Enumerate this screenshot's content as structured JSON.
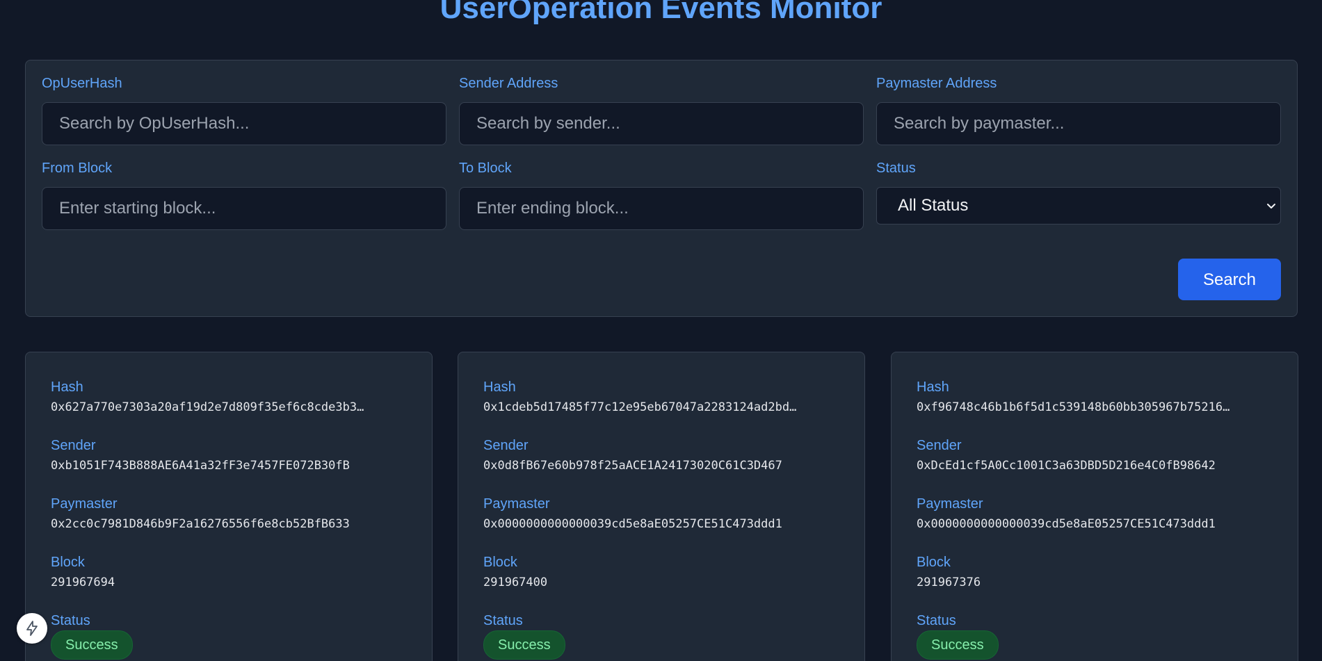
{
  "header": {
    "title": "UserOperation Events Monitor"
  },
  "filters": {
    "op_user_hash": {
      "label": "OpUserHash",
      "placeholder": "Search by OpUserHash...",
      "value": ""
    },
    "sender_address": {
      "label": "Sender Address",
      "placeholder": "Search by sender...",
      "value": ""
    },
    "paymaster_address": {
      "label": "Paymaster Address",
      "placeholder": "Search by paymaster...",
      "value": ""
    },
    "from_block": {
      "label": "From Block",
      "placeholder": "Enter starting block...",
      "value": ""
    },
    "to_block": {
      "label": "To Block",
      "placeholder": "Enter ending block...",
      "value": ""
    },
    "status": {
      "label": "Status",
      "selected": "All Status"
    },
    "search_label": "Search"
  },
  "field_labels": {
    "hash": "Hash",
    "sender": "Sender",
    "paymaster": "Paymaster",
    "block": "Block",
    "status": "Status"
  },
  "events": [
    {
      "hash": "0x627a770e7303a20af19d2e7d809f35ef6c8cde3b3…",
      "sender": "0xb1051F743B888AE6A41a32fF3e7457FE072B30fB",
      "paymaster": "0x2cc0c7981D846b9F2a16276556f6e8cb52BfB633",
      "block": "291967694",
      "status": "Success"
    },
    {
      "hash": "0x1cdeb5d17485f77c12e95eb67047a2283124ad2bd…",
      "sender": "0x0d8fB67e60b978f25aACE1A24173020C61C3D467",
      "paymaster": "0x0000000000000039cd5e8aE05257CE51C473ddd1",
      "block": "291967400",
      "status": "Success"
    },
    {
      "hash": "0xf96748c46b1b6f5d1c539148b60bb305967b75216…",
      "sender": "0xDcEd1cf5A0Cc1001C3a63DBD5D216e4C0fB98642",
      "paymaster": "0x0000000000000039cd5e8aE05257CE51C473ddd1",
      "block": "291967376",
      "status": "Success"
    }
  ],
  "colors": {
    "background": "#111827",
    "panel": "#1f2937",
    "accent": "#60a5fa",
    "button": "#2563eb",
    "success_text": "#86efac",
    "success_bg": "#14532d"
  },
  "icons": {
    "status_chevron": "chevron-down-icon",
    "floating_button": "lightning-icon"
  }
}
